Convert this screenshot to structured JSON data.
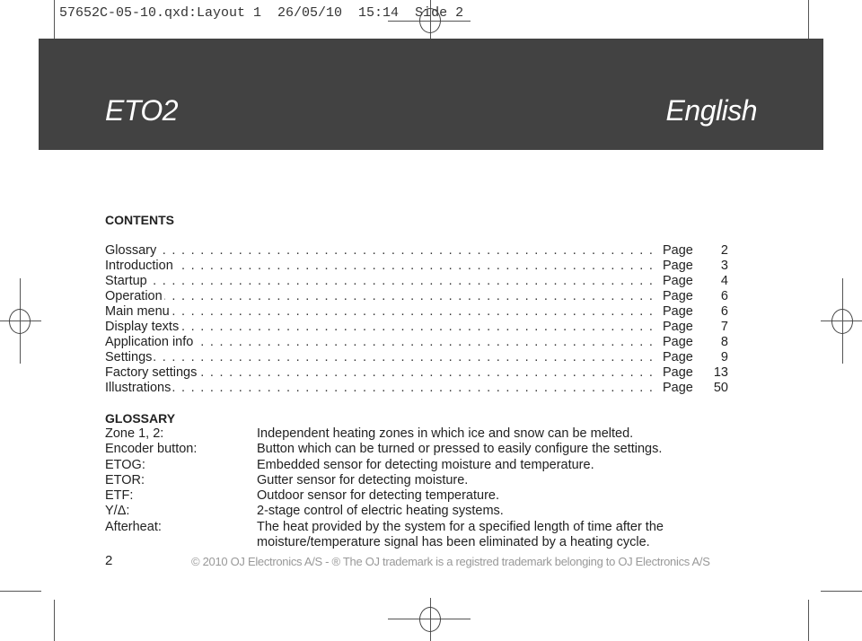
{
  "slug": "57652C-05-10.qxd:Layout 1  26/05/10  15:14  Side 2",
  "header": {
    "product": "ETO2",
    "language": "English"
  },
  "contents": {
    "heading": "CONTENTS",
    "items": [
      {
        "label": "Glossary",
        "page_word": "Page",
        "page": "2"
      },
      {
        "label": "Introduction",
        "page_word": "Page",
        "page": "3"
      },
      {
        "label": "Startup",
        "page_word": "Page",
        "page": "4"
      },
      {
        "label": "Operation",
        "page_word": "Page",
        "page": "6"
      },
      {
        "label": "Main menu",
        "page_word": "Page",
        "page": "6"
      },
      {
        "label": "Display texts",
        "page_word": "Page",
        "page": "7"
      },
      {
        "label": "Application info",
        "page_word": "Page",
        "page": "8"
      },
      {
        "label": "Settings",
        "page_word": "Page",
        "page": "9"
      },
      {
        "label": "Factory settings",
        "page_word": "Page",
        "page": "13"
      },
      {
        "label": "Illustrations",
        "page_word": "Page",
        "page": "50"
      }
    ]
  },
  "glossary": {
    "heading": "GLOSSARY",
    "items": [
      {
        "term": "Zone 1, 2:",
        "definition": "Independent heating zones in which ice and snow can be melted."
      },
      {
        "term": "Encoder button:",
        "definition": "Button which can be turned or pressed to easily configure the settings."
      },
      {
        "term": "ETOG:",
        "definition": "Embedded sensor for detecting moisture and temperature."
      },
      {
        "term": "ETOR:",
        "definition": "Gutter sensor for detecting moisture."
      },
      {
        "term": "ETF:",
        "definition": "Outdoor sensor for detecting temperature."
      },
      {
        "term": "Y/Δ:",
        "definition": "2-stage control of electric heating systems."
      },
      {
        "term": "Afterheat:",
        "definition": "The heat provided by the system for a specified length of time after the moisture/temperature signal has been eliminated by a heating cycle."
      }
    ]
  },
  "footer": {
    "page_number": "2",
    "copyright": "© 2010 OJ Electronics A/S - ® The OJ trademark is a registred trademark belonging to OJ Electronics A/S"
  }
}
